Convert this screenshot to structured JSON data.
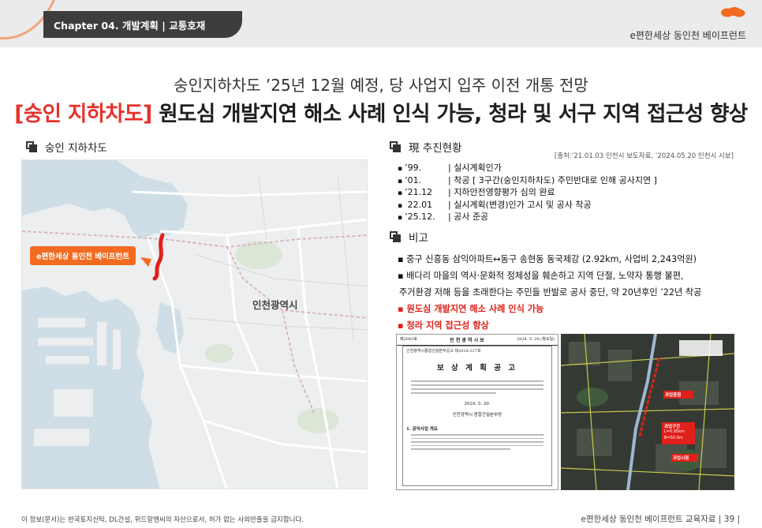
{
  "header": {
    "chapter": "Chapter 04. 개발계획 | 교통호재",
    "brand": "e편한세상 동인천 베이프런트",
    "accent_color": "#f26b21"
  },
  "subtitle": "숭인지하차도 ’25년 12월 예정, 당 사업지 입주 이전 개통 전망",
  "title": {
    "accent": "[숭인 지하차도]",
    "rest": " 원도심 개발지연 해소 사례 인식 가능, 청라 및 서구 지역 접근성 향상",
    "accent_color": "#e8312a"
  },
  "left_section": {
    "label": "숭인 지하차도",
    "map": {
      "callout": "e편한세상 동인천 베이프런트",
      "city_label": "인천광역시"
    }
  },
  "status_section": {
    "label": "現 추진현황",
    "source": "[출처:’21.01.03 인천시 보도자료, ’2024.05.20 인천시 시보]",
    "items": [
      {
        "year": "’99.",
        "text": "|  실시계획인가"
      },
      {
        "year": "’01.",
        "text": "|  착공 [ 3구간(숭인지하차도) 주민반대로 인해 공사지연 ]"
      },
      {
        "year": "’21.12",
        "text": "|  지하안전영향평가 심의 완료"
      },
      {
        "year": " 22.01",
        "text": "|  실시계획(변경)인가 고시 및 공사 착공"
      },
      {
        "year": "’25.12.",
        "text": "|  공사 준공"
      }
    ]
  },
  "notes_section": {
    "label": "비고",
    "items": [
      "▪ 중구 신흥동 삼익아파트↔동구 송현동 동국제강 (2.92km, 사업비 2,243억원)",
      "▪ 배다리 마을의 역사·문화적 정체성을 훼손하고 지역 단절, 노약자 통행 불편,",
      "  주거환경 저해 등을 초래한다는 주민들 반발로 공사 중단, 약 20년후인 ’22년 착공"
    ],
    "highlights": [
      "▪ 원도심 개발지연 해소 사례 인식 가능",
      "▪ 청라 지역 접근성 향상"
    ]
  },
  "document_image": {
    "header_left": "제2043호",
    "header_title": "인 천 광 역 시 보",
    "header_date": "2024. 5. 20.(월요일)",
    "ref": "인천광역시종합건설본부공고 제2024-227호",
    "notice_title": "보 상 계 획 공 고",
    "date": "2024. 5. 20.",
    "org": "인천광역시 종합건설본부장",
    "section": "1. 공익사업 개요"
  },
  "aerial_image": {
    "labels": [
      "과업종점",
      "과업구간",
      "L=0.95km",
      "B=50.0m",
      "과업시점"
    ]
  },
  "footer": {
    "left": "이 정보(문서)는 한국토지신탁, DL건설, 위드알앤씨의 자산으로서, 허가 없는 사외반출을 금지합니다.",
    "right": "e편한세상 동인천 베이프런트 교육자료 | 39 |"
  }
}
